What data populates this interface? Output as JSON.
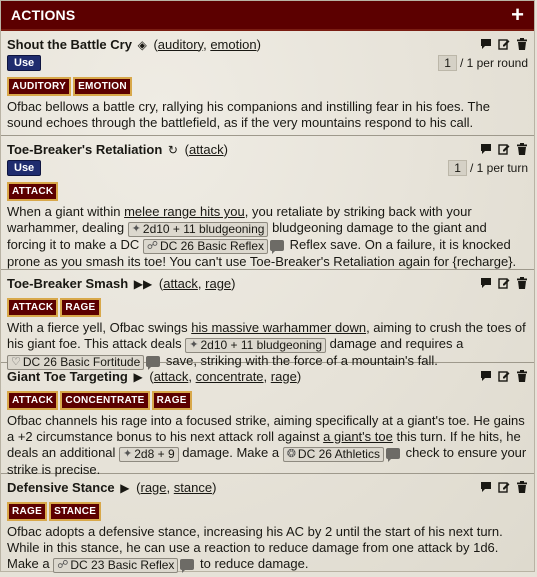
{
  "header": {
    "title": "ACTIONS",
    "add_label": "+"
  },
  "actions": [
    {
      "name": "Shout the Battle Cry",
      "glyph": "◈",
      "traits": [
        "auditory",
        "emotion"
      ],
      "use_label": "Use",
      "uses_current": "1",
      "uses_text": "/ 1 per round",
      "tags": [
        "AUDITORY",
        "EMOTION"
      ],
      "desc": "Ofbac bellows a battle cry, rallying his companions and instilling fear in his foes. The sound echoes through the battlefield, as if the very mountains respond to his call."
    },
    {
      "name": "Toe-Breaker's Retaliation",
      "glyph": "↻",
      "traits": [
        "attack"
      ],
      "use_label": "Use",
      "uses_current": "1",
      "uses_text": "/ 1 per turn",
      "tags": [
        "ATTACK"
      ],
      "desc_a": "When a giant within ",
      "desc_u": "melee range hits you",
      "desc_b": ", you retaliate by striking back with your warhammer, dealing ",
      "roll1": "2d10 + 11 bludgeoning",
      "desc_c": " bludgeoning damage to the giant and forcing it to make a DC ",
      "roll2": "DC 26 Basic Reflex",
      "desc_d": " Reflex save. On a failure, it is knocked prone as you smash its toe! You can't use Toe-Breaker's Retaliation again for {recharge}."
    },
    {
      "name": "Toe-Breaker Smash",
      "glyph": "▶▶",
      "traits": [
        "attack",
        "rage"
      ],
      "tags": [
        "ATTACK",
        "RAGE"
      ],
      "desc_a": "With a fierce yell, Ofbac swings ",
      "desc_u": "his massive warhammer down",
      "desc_b": ", aiming to crush the toes of his giant foe. This attack deals ",
      "roll1": "2d10 + 11 bludgeoning",
      "desc_c": " damage and requires a ",
      "roll2": "DC 26 Basic Fortitude",
      "desc_d": " save, striking with the force of a mountain's fall."
    },
    {
      "name": "Giant Toe Targeting",
      "glyph": "▶",
      "traits": [
        "attack",
        "concentrate",
        "rage"
      ],
      "tags": [
        "ATTACK",
        "CONCENTRATE",
        "RAGE"
      ],
      "desc_a": "Ofbac channels his rage into a focused strike, aiming specifically at a giant's toe. He gains a +2 circumstance bonus to his next attack roll against ",
      "desc_u": "a giant's toe",
      "desc_b": " this turn. If he hits, he deals an additional ",
      "roll1": "2d8 + 9",
      "desc_c": " damage. Make a ",
      "roll2": "DC 26 Athletics",
      "desc_d": " check to ensure your strike is precise."
    },
    {
      "name": "Defensive Stance",
      "glyph": "▶",
      "traits": [
        "rage",
        "stance"
      ],
      "tags": [
        "RAGE",
        "STANCE"
      ],
      "desc_a": "Ofbac adopts a defensive stance, increasing his AC by 2 until the start of his next turn. While in this stance, he can use a reaction to reduce damage from one attack by 1d6. Make a ",
      "roll2": "DC 23 Basic Reflex",
      "desc_d": " to reduce damage."
    }
  ],
  "icons": [
    "chat-icon",
    "edit-icon",
    "trash-icon",
    "add-icon",
    "d20-icon",
    "running-icon",
    "heart-icon"
  ],
  "colors": {
    "header_bg": "#5c0000",
    "tag_border": "#d8a84a",
    "use_bg": "#1f2c6e"
  }
}
